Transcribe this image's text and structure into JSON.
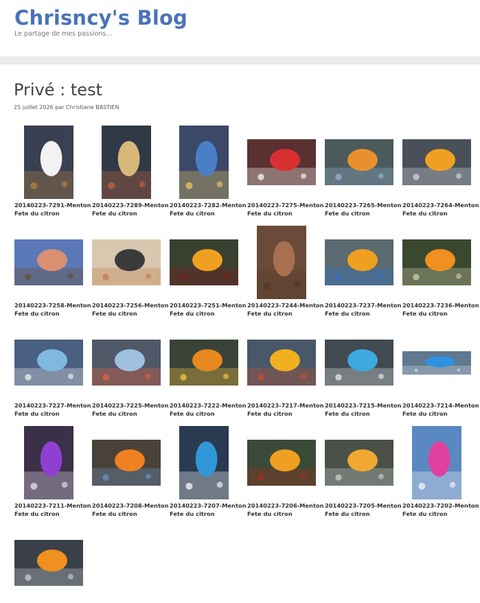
{
  "site": {
    "title": "Chrisncy's Blog",
    "tagline": "Le partage de mes passions..."
  },
  "post": {
    "title": "Privé : test",
    "meta": "25 juillet 2026 par Christiane BASTIEN"
  },
  "colors": {
    "title_blue": "#4a73b8",
    "band_gray": "#ececec"
  },
  "gallery": [
    {
      "name": "20140223-7291-Menton",
      "subtitle": "Fete du citron",
      "orientation": "portrait",
      "bg": "#3a3f52",
      "accent": "#f2f2f2",
      "accent2": "#b08040"
    },
    {
      "name": "20140223-7289-Menton",
      "subtitle": "Fete du citron",
      "orientation": "portrait",
      "bg": "#2f3a46",
      "accent": "#d8b878",
      "accent2": "#c06040"
    },
    {
      "name": "20140223-7282-Menton",
      "subtitle": "Fete du citron",
      "orientation": "portrait",
      "bg": "#3b4868",
      "accent": "#4a7fc8",
      "accent2": "#e0c060"
    },
    {
      "name": "20140223-7275-Menton",
      "subtitle": "Fete du citron",
      "orientation": "landscape",
      "bg": "#5a3030",
      "accent": "#d83030",
      "accent2": "#f0f0f0"
    },
    {
      "name": "20140223-7265-Menton",
      "subtitle": "Fete du citron",
      "orientation": "landscape",
      "bg": "#4c5a5c",
      "accent": "#e89030",
      "accent2": "#90b0c8"
    },
    {
      "name": "20140223-7264-Menton",
      "subtitle": "Fete du citron",
      "orientation": "landscape",
      "bg": "#4a5058",
      "accent": "#f0a020",
      "accent2": "#c8d0d8"
    },
    {
      "name": "20140223-7258-Menton",
      "subtitle": "Fete du citron",
      "orientation": "landscape",
      "bg": "#5a78b8",
      "accent": "#d89070",
      "accent2": "#6a5030"
    },
    {
      "name": "20140223-7256-Menton",
      "subtitle": "Fete du citron",
      "orientation": "landscape",
      "bg": "#d8c8b0",
      "accent": "#3a3a3a",
      "accent2": "#c08050"
    },
    {
      "name": "20140223-7251-Menton",
      "subtitle": "Fete du citron",
      "orientation": "landscape",
      "bg": "#3a4030",
      "accent": "#f0a020",
      "accent2": "#7a2020"
    },
    {
      "name": "20140223-7244-Menton",
      "subtitle": "Fete du citron",
      "orientation": "portrait",
      "bg": "#6a4a38",
      "accent": "#a87050",
      "accent2": "#503828"
    },
    {
      "name": "20140223-7237-Menton",
      "subtitle": "Fete du citron",
      "orientation": "landscape",
      "bg": "#5a6a70",
      "accent": "#f0a020",
      "accent2": "#3070c0"
    },
    {
      "name": "20140223-7236-Menton",
      "subtitle": "Fete du citron",
      "orientation": "landscape",
      "bg": "#3a4830",
      "accent": "#f09020",
      "accent2": "#c8c8a0"
    },
    {
      "name": "20140223-7227-Menton",
      "subtitle": "Fete du citron",
      "orientation": "landscape",
      "bg": "#4a6080",
      "accent": "#80b8e0",
      "accent2": "#e8e8e8"
    },
    {
      "name": "20140223-7225-Menton",
      "subtitle": "Fete du citron",
      "orientation": "landscape",
      "bg": "#505868",
      "accent": "#a0c0e0",
      "accent2": "#e06040"
    },
    {
      "name": "20140223-7222-Menton",
      "subtitle": "Fete du citron",
      "orientation": "landscape",
      "bg": "#3a4238",
      "accent": "#e88820",
      "accent2": "#f0c040"
    },
    {
      "name": "20140223-7217-Menton",
      "subtitle": "Fete du citron",
      "orientation": "landscape",
      "bg": "#485868",
      "accent": "#f0b020",
      "accent2": "#c05030"
    },
    {
      "name": "20140223-7215-Menton",
      "subtitle": "Fete du citron",
      "orientation": "landscape",
      "bg": "#404a50",
      "accent": "#40a8e0",
      "accent2": "#e0e0e0"
    },
    {
      "name": "20140223-7214-Menton",
      "subtitle": "Fete du citron",
      "orientation": "panorama",
      "bg": "#607890",
      "accent": "#3090e0",
      "accent2": "#d0d8e0"
    },
    {
      "name": "20140223-7211-Menton",
      "subtitle": "Fete du citron",
      "orientation": "portrait",
      "bg": "#3a3048",
      "accent": "#9040d0",
      "accent2": "#e0d8e8"
    },
    {
      "name": "20140223-7208-Menton",
      "subtitle": "Fete du citron",
      "orientation": "landscape",
      "bg": "#4a4238",
      "accent": "#f08020",
      "accent2": "#6a90c0"
    },
    {
      "name": "20140223-7207-Menton",
      "subtitle": "Fete du citron",
      "orientation": "portrait",
      "bg": "#2a3a50",
      "accent": "#3098d8",
      "accent2": "#f0f0f0"
    },
    {
      "name": "20140223-7206-Menton",
      "subtitle": "Fete du citron",
      "orientation": "landscape",
      "bg": "#3a4a38",
      "accent": "#f0a020",
      "accent2": "#a03020"
    },
    {
      "name": "20140223-7205-Menton",
      "subtitle": "Fete du citron",
      "orientation": "landscape",
      "bg": "#4a5048",
      "accent": "#f0a830",
      "accent2": "#c0c8c8"
    },
    {
      "name": "20140223-7202-Menton",
      "subtitle": "Fete du citron",
      "orientation": "portrait",
      "bg": "#5a88c0",
      "accent": "#e040a0",
      "accent2": "#f0f0f0"
    },
    {
      "name": "",
      "subtitle": "",
      "orientation": "landscape",
      "bg": "#3a4048",
      "accent": "#f09020",
      "accent2": "#c0c8d0"
    }
  ]
}
